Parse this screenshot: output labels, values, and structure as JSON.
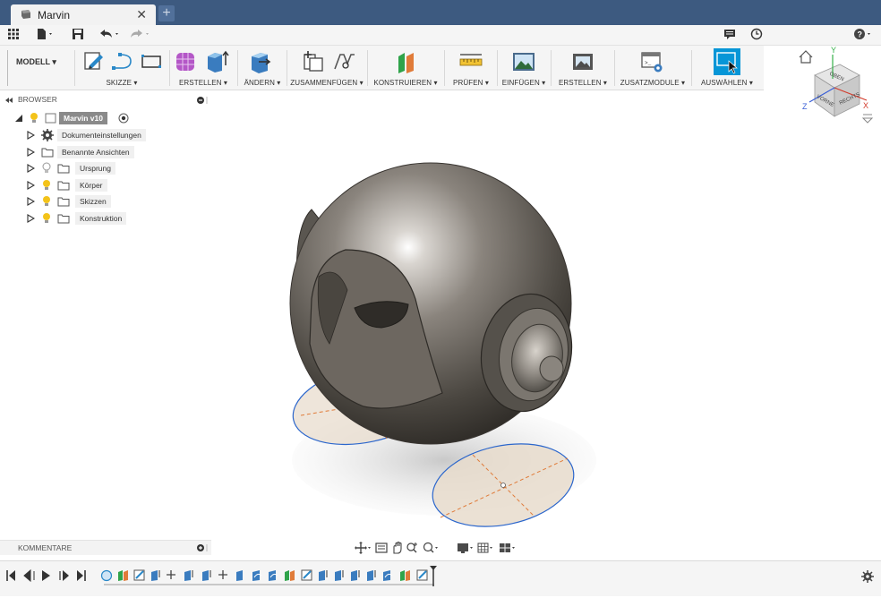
{
  "tab": {
    "title": "Marvin",
    "close": "✕",
    "new": "+"
  },
  "model_button": "MODELL ▾",
  "ribbon": {
    "groups": [
      {
        "label": "SKIZZE ▾"
      },
      {
        "label": "ERSTELLEN ▾"
      },
      {
        "label": "ÄNDERN ▾"
      },
      {
        "label": "ZUSAMMENFÜGEN ▾"
      },
      {
        "label": "KONSTRUIEREN ▾"
      },
      {
        "label": "PRÜFEN ▾"
      },
      {
        "label": "EINFÜGEN ▾"
      },
      {
        "label": "ERSTELLEN ▾"
      },
      {
        "label": "ZUSATZMODULE ▾"
      },
      {
        "label": "AUSWÄHLEN ▾"
      }
    ]
  },
  "viewcube": {
    "top": "OBEN",
    "front": "VORNE",
    "right": "RECHTS",
    "axis_x": "X",
    "axis_y": "Y",
    "axis_z": "Z"
  },
  "browser": {
    "title": "BROWSER",
    "root": "Marvin v10",
    "items": [
      {
        "label": "Dokumenteinstellungen"
      },
      {
        "label": "Benannte Ansichten"
      },
      {
        "label": "Ursprung"
      },
      {
        "label": "Körper"
      },
      {
        "label": "Skizzen"
      },
      {
        "label": "Konstruktion"
      }
    ]
  },
  "comments": {
    "title": "KOMMENTARE"
  },
  "colors": {
    "titlebar": "#3d5a80",
    "accent": "#0696d7",
    "selection_ring": "#2b66cc",
    "sketch_dash": "#e07b39",
    "body_metal": "#6f6a64"
  }
}
